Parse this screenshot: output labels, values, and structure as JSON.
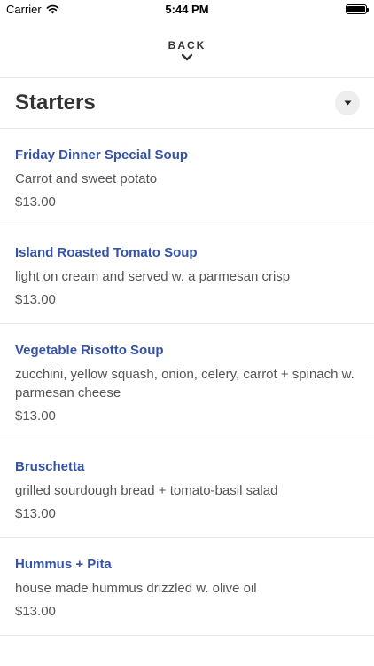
{
  "status_bar": {
    "carrier": "Carrier",
    "time": "5:44 PM",
    "wifi_icon": "wifi-icon",
    "battery_icon": "battery-icon"
  },
  "nav": {
    "back_label": "BACK",
    "chevron_icon": "chevron-down-icon"
  },
  "section": {
    "title": "Starters",
    "dropdown_icon": "caret-down-icon"
  },
  "colors": {
    "item_name": "#3553a6",
    "text_secondary": "#555555",
    "divider": "#e6e6e6"
  },
  "items": [
    {
      "name": "Friday Dinner Special Soup",
      "description": "Carrot and sweet potato",
      "price": "$13.00"
    },
    {
      "name": "Island Roasted Tomato Soup",
      "description": "light on cream and served w. a parmesan crisp",
      "price": "$13.00"
    },
    {
      "name": "Vegetable Risotto Soup",
      "description": "zucchini, yellow squash, onion, celery, carrot + spinach w. parmesan cheese",
      "price": "$13.00"
    },
    {
      "name": "Bruschetta",
      "description": "grilled sourdough bread + tomato-basil salad",
      "price": "$13.00"
    },
    {
      "name": "Hummus + Pita",
      "description": "house made hummus drizzled w. olive oil",
      "price": "$13.00"
    }
  ]
}
